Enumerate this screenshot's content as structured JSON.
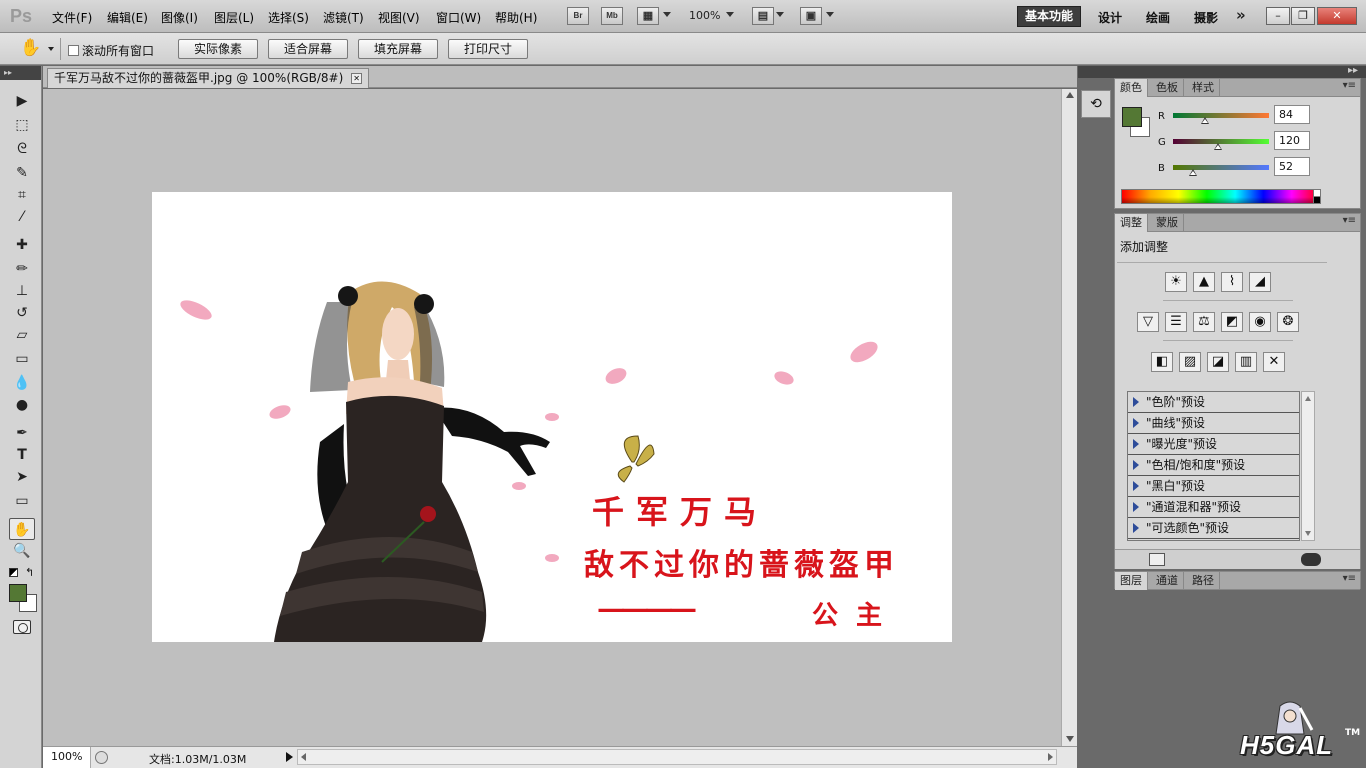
{
  "app": {
    "logo": "Ps"
  },
  "menu": [
    "文件(F)",
    "编辑(E)",
    "图像(I)",
    "图层(L)",
    "选择(S)",
    "滤镜(T)",
    "视图(V)",
    "窗口(W)",
    "帮助(H)"
  ],
  "menubar_tools": {
    "bridge": "Br",
    "minibridge": "Mb",
    "zoom": "100%"
  },
  "workspaces": {
    "active": "基本功能",
    "items": [
      "设计",
      "绘画",
      "摄影"
    ],
    "more": "»"
  },
  "window_controls": {
    "minimize": "–",
    "restore": "❐",
    "close": "✕"
  },
  "options": {
    "scroll_all": "滚动所有窗口",
    "buttons": [
      "实际像素",
      "适合屏幕",
      "填充屏幕",
      "打印尺寸"
    ]
  },
  "tools": {
    "icons": [
      "move-icon",
      "marquee-icon",
      "lasso-icon",
      "quick-selection-icon",
      "crop-icon",
      "eyedropper-icon",
      "healing-brush-icon",
      "brush-icon",
      "clone-stamp-icon",
      "history-brush-icon",
      "eraser-icon",
      "gradient-icon",
      "blur-icon",
      "dodge-icon",
      "pen-icon",
      "type-icon",
      "path-selection-icon",
      "rectangle-icon",
      "hand-icon",
      "zoom-icon"
    ],
    "foreground_color": "#547834",
    "background_color": "#ffffff"
  },
  "document": {
    "tab_title": "千军万马敌不过你的蔷薇盔甲.jpg @ 100%(RGB/8#)",
    "close": "✕",
    "zoom": "100%",
    "doc_info": "文档:1.03M/1.03M"
  },
  "image": {
    "poem": [
      "千军万马",
      "敌不过你的蔷薇盔甲",
      "————",
      "公主"
    ],
    "text_color": "#d8141b"
  },
  "color_panel": {
    "tabs": [
      "颜色",
      "色板",
      "样式"
    ],
    "menu": "▾≡",
    "r_label": "R",
    "r": "84",
    "g_label": "G",
    "g": "120",
    "b_label": "B",
    "b": "52",
    "swatch": "#547834"
  },
  "adjustments_panel": {
    "tabs": [
      "调整",
      "蒙版"
    ],
    "title": "添加调整",
    "presets": [
      "\"色阶\"预设",
      "\"曲线\"预设",
      "\"曝光度\"预设",
      "\"色相/饱和度\"预设",
      "\"黑白\"预设",
      "\"通道混和器\"预设",
      "\"可选颜色\"预设"
    ]
  },
  "layers_panel": {
    "tabs": [
      "图层",
      "通道",
      "路径"
    ]
  },
  "watermark": {
    "text": "H5GAL",
    "tm": "TM"
  }
}
